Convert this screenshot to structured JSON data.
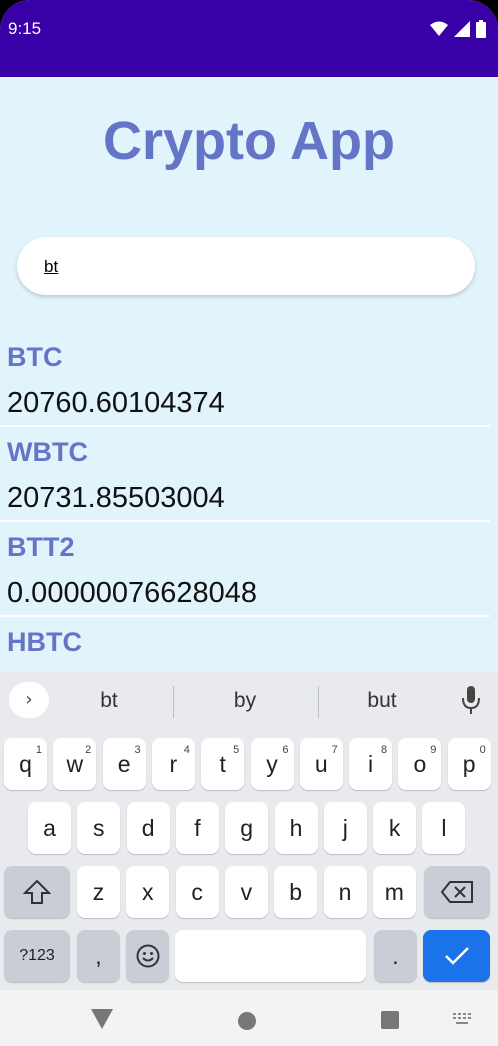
{
  "status_bar": {
    "time": "9:15"
  },
  "app": {
    "title": "Crypto App"
  },
  "search": {
    "value": "bt",
    "placeholder": ""
  },
  "coins": [
    {
      "symbol": "BTC",
      "price": "20760.60104374"
    },
    {
      "symbol": "WBTC",
      "price": "20731.85503004"
    },
    {
      "symbol": "BTT2",
      "price": "0.00000076628048"
    },
    {
      "symbol": "HBTC",
      "price": ""
    }
  ],
  "keyboard": {
    "suggestions": [
      "bt",
      "by",
      "but"
    ],
    "row1": [
      "q",
      "w",
      "e",
      "r",
      "t",
      "y",
      "u",
      "i",
      "o",
      "p"
    ],
    "row1_hints": [
      "1",
      "2",
      "3",
      "4",
      "5",
      "6",
      "7",
      "8",
      "9",
      "0"
    ],
    "row2": [
      "a",
      "s",
      "d",
      "f",
      "g",
      "h",
      "j",
      "k",
      "l"
    ],
    "row3": [
      "z",
      "x",
      "c",
      "v",
      "b",
      "n",
      "m"
    ],
    "symbols_key": "?123",
    "comma_key": ",",
    "period_key": "."
  },
  "colors": {
    "status_bar": "#3800a7",
    "accent": "#6474c7",
    "background": "#e1f4fc",
    "enter_key": "#1a73e8"
  }
}
